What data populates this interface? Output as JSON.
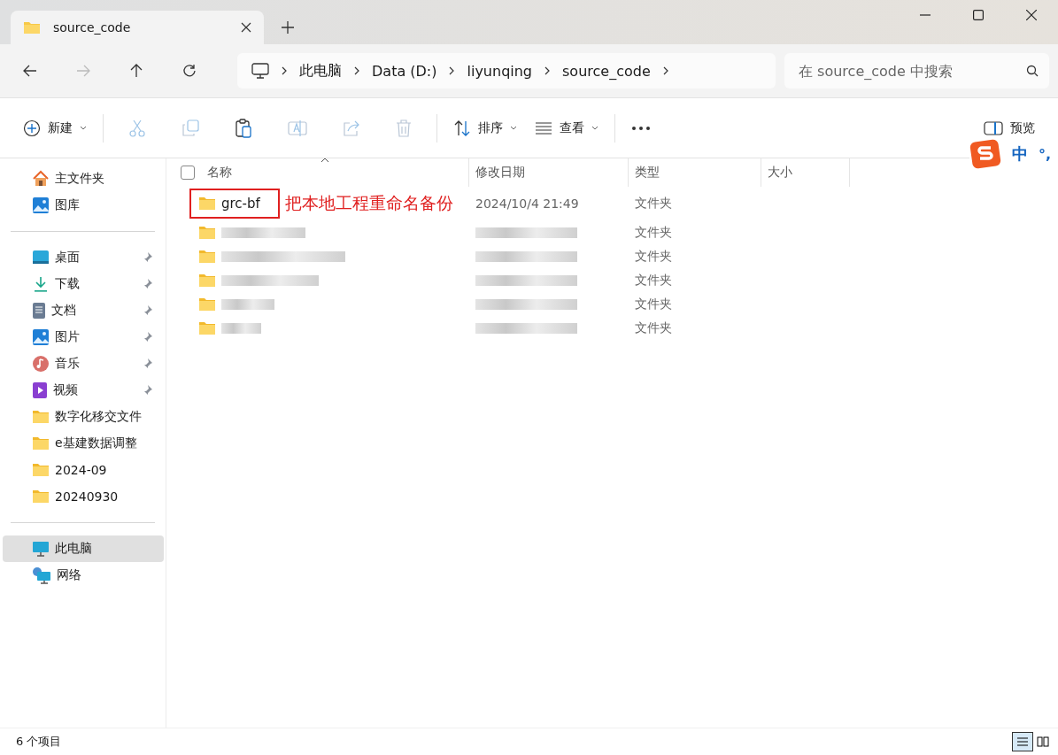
{
  "window": {
    "tab_title": "source_code"
  },
  "breadcrumb": [
    "此电脑",
    "Data (D:)",
    "liyunqing",
    "source_code"
  ],
  "search": {
    "placeholder": "在 source_code 中搜索"
  },
  "toolbar": [
    {
      "kind": "new",
      "label": "新建",
      "disabled": false
    },
    {
      "kind": "cut",
      "disabled": true
    },
    {
      "kind": "copy",
      "disabled": true
    },
    {
      "kind": "paste",
      "disabled": false
    },
    {
      "kind": "rename",
      "disabled": true
    },
    {
      "kind": "share",
      "disabled": true
    },
    {
      "kind": "delete",
      "disabled": true
    },
    {
      "kind": "sort",
      "label": "排序",
      "disabled": false
    },
    {
      "kind": "view",
      "label": "查看",
      "disabled": false
    },
    {
      "kind": "more",
      "disabled": false
    }
  ],
  "preview_button": "预览",
  "ime": {
    "mode": "中",
    "punct": "°,"
  },
  "sidebar": {
    "sections": [
      [
        {
          "kind": "home",
          "label": "主文件夹",
          "pinned": false,
          "selected": false
        },
        {
          "kind": "gallery",
          "label": "图库",
          "pinned": false,
          "selected": false
        }
      ],
      [
        {
          "kind": "desktop",
          "label": "桌面",
          "pinned": true,
          "selected": false
        },
        {
          "kind": "download",
          "label": "下载",
          "pinned": true,
          "selected": false
        },
        {
          "kind": "document",
          "label": "文档",
          "pinned": true,
          "selected": false
        },
        {
          "kind": "picture",
          "label": "图片",
          "pinned": true,
          "selected": false
        },
        {
          "kind": "music",
          "label": "音乐",
          "pinned": true,
          "selected": false
        },
        {
          "kind": "video",
          "label": "视频",
          "pinned": true,
          "selected": false
        },
        {
          "kind": "folder",
          "label": "数字化移交文件",
          "pinned": false,
          "selected": false
        },
        {
          "kind": "folder",
          "label": "e基建数据调整",
          "pinned": false,
          "selected": false
        },
        {
          "kind": "folder",
          "label": "2024-09",
          "pinned": false,
          "selected": false
        },
        {
          "kind": "folder",
          "label": "20240930",
          "pinned": false,
          "selected": false
        }
      ],
      [
        {
          "kind": "pc",
          "label": "此电脑",
          "pinned": false,
          "selected": true
        },
        {
          "kind": "network",
          "label": "网络",
          "pinned": false,
          "selected": false
        }
      ]
    ]
  },
  "table": {
    "select_all_checked": false,
    "columns": [
      "名称",
      "修改日期",
      "类型",
      "大小"
    ],
    "rows": [
      {
        "name": "grc-bf",
        "modified": "2024/10/4 21:49",
        "type": "文件夹",
        "boxed": true
      },
      {
        "type": "文件夹",
        "boxed": false
      },
      {
        "type": "文件夹",
        "boxed": false
      },
      {
        "type": "文件夹",
        "boxed": false
      },
      {
        "type": "文件夹",
        "boxed": false
      },
      {
        "type": "文件夹",
        "boxed": false
      }
    ]
  },
  "annotation": "把本地工程重命名备份",
  "status_bar": {
    "item_count": "6 个项目"
  }
}
